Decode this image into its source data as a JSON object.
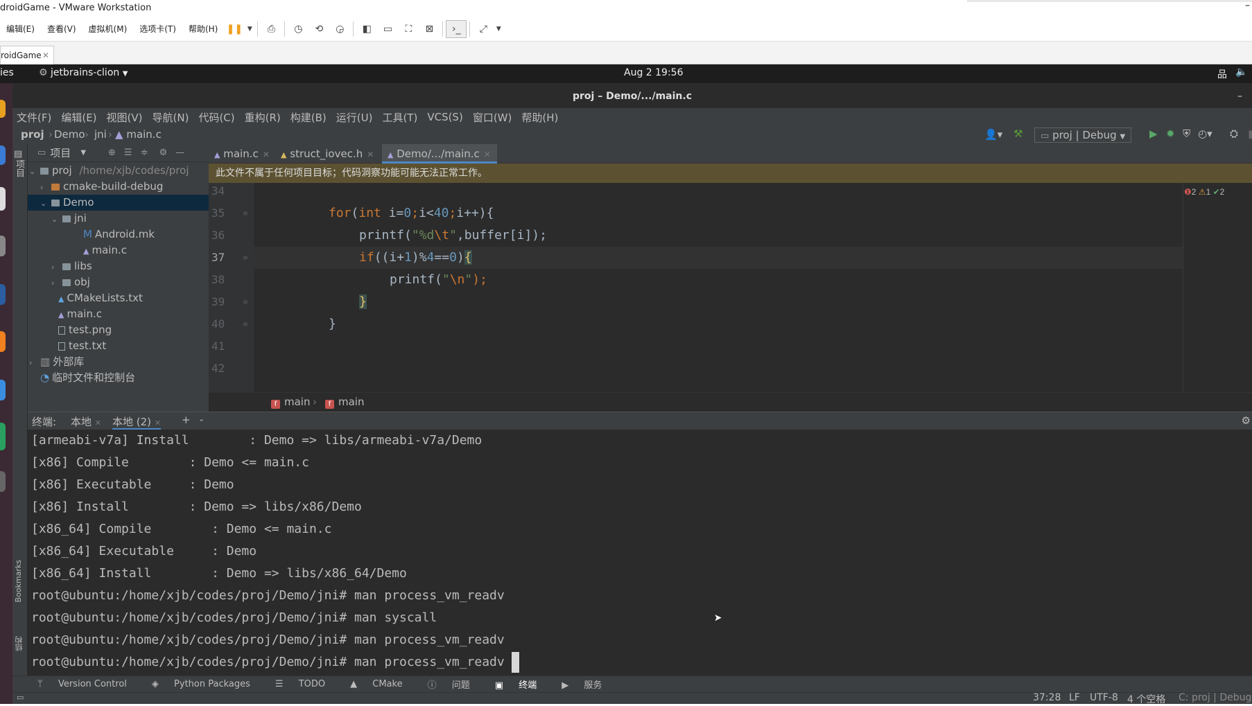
{
  "vmware": {
    "window_title": "droidGame - VMware Workstation",
    "menu": [
      "编辑(E)",
      "查看(V)",
      "虚拟机(M)",
      "选项卡(T)",
      "帮助(H)"
    ],
    "tab_label": "roidGame"
  },
  "gnome": {
    "activities": "ies",
    "app_menu": "jetbrains-clion",
    "clock": "Aug 2  19:56"
  },
  "ide": {
    "title": "proj – Demo/.../main.c",
    "menu": [
      "文件(F)",
      "编辑(E)",
      "视图(V)",
      "导航(N)",
      "代码(C)",
      "重构(R)",
      "构建(B)",
      "运行(U)",
      "工具(T)",
      "VCS(S)",
      "窗口(W)",
      "帮助(H)"
    ],
    "breadcrumb": [
      "proj",
      "Demo",
      "jni",
      "main.c"
    ],
    "run_config": "proj | Debug",
    "left_strip_label": "项目",
    "left_strip_bookmarks": "Bookmarks",
    "left_strip_structure": "结构"
  },
  "project": {
    "header": "项目",
    "tree": [
      {
        "label": "proj",
        "path": "/home/xjb/codes/proj"
      },
      {
        "label": "cmake-build-debug"
      },
      {
        "label": "Demo"
      },
      {
        "label": "jni"
      },
      {
        "label": "Android.mk"
      },
      {
        "label": "main.c"
      },
      {
        "label": "libs"
      },
      {
        "label": "obj"
      },
      {
        "label": "CMakeLists.txt"
      },
      {
        "label": "main.c"
      },
      {
        "label": "test.png"
      },
      {
        "label": "test.txt"
      },
      {
        "label": "外部库"
      },
      {
        "label": "临时文件和控制台"
      }
    ]
  },
  "editor": {
    "tabs": [
      "main.c",
      "struct_iovec.h",
      "Demo/.../main.c"
    ],
    "banner": "此文件不属于任何项目目标；代码洞察功能可能无法正常工作。",
    "inspections": {
      "errors": "2",
      "warnings": "1",
      "ok": "2"
    },
    "line_numbers": [
      "34",
      "35",
      "36",
      "37",
      "38",
      "39",
      "40",
      "41",
      "42"
    ],
    "code": {
      "l35": {
        "kw1": "for",
        "p1": "(",
        "kw2": "int",
        "p2": " i=",
        "n1": "0",
        "p3": ";",
        "p4": "i<",
        "n2": "40",
        "p5": ";",
        "p6": "i++){"
      },
      "l36": {
        "p1": "printf(",
        "s1": "\"%d",
        "e1": "\\t",
        "s2": "\"",
        "p2": ",buffer[i]);"
      },
      "l37": {
        "kw1": "if",
        "p1": "((i+",
        "n1": "1",
        "p2": ")%",
        "n2": "4",
        "p3": "==",
        "n3": "0",
        "p4": ")",
        "b1": "{"
      },
      "l38": {
        "p1": "printf(",
        "s1": "\"",
        "e1": "\\n",
        "s2": "\"",
        "p2": ");"
      },
      "l39": {
        "b1": "}"
      },
      "l40": {
        "p1": "}"
      }
    },
    "breadcrumb": [
      "main",
      "main"
    ]
  },
  "terminal": {
    "label": "终端:",
    "tabs": [
      "本地",
      "本地 (2)"
    ],
    "lines": [
      "[armeabi-v7a] Install        : Demo => libs/armeabi-v7a/Demo",
      "[x86] Compile        : Demo <= main.c",
      "[x86] Executable     : Demo",
      "[x86] Install        : Demo => libs/x86/Demo",
      "[x86_64] Compile        : Demo <= main.c",
      "[x86_64] Executable     : Demo",
      "[x86_64] Install        : Demo => libs/x86_64/Demo",
      "root@ubuntu:/home/xjb/codes/proj/Demo/jni# man process_vm_readv",
      "root@ubuntu:/home/xjb/codes/proj/Demo/jni# man syscall",
      "root@ubuntu:/home/xjb/codes/proj/Demo/jni# man process_vm_readv",
      "root@ubuntu:/home/xjb/codes/proj/Demo/jni# man process_vm_readv"
    ]
  },
  "toolwindows": [
    "Version Control",
    "Python Packages",
    "TODO",
    "CMake",
    "问题",
    "终端",
    "服务"
  ],
  "status": {
    "position": "37:28",
    "line_sep": "LF",
    "encoding": "UTF-8",
    "indent": "4 个空格",
    "context": "C: proj | Debug"
  },
  "colors": {
    "ide_bg": "#2b2b2b",
    "panel_bg": "#3c3f41",
    "keyword": "#cc7832",
    "number": "#6897bb",
    "string": "#6a8759",
    "selection": "#0d293e"
  }
}
